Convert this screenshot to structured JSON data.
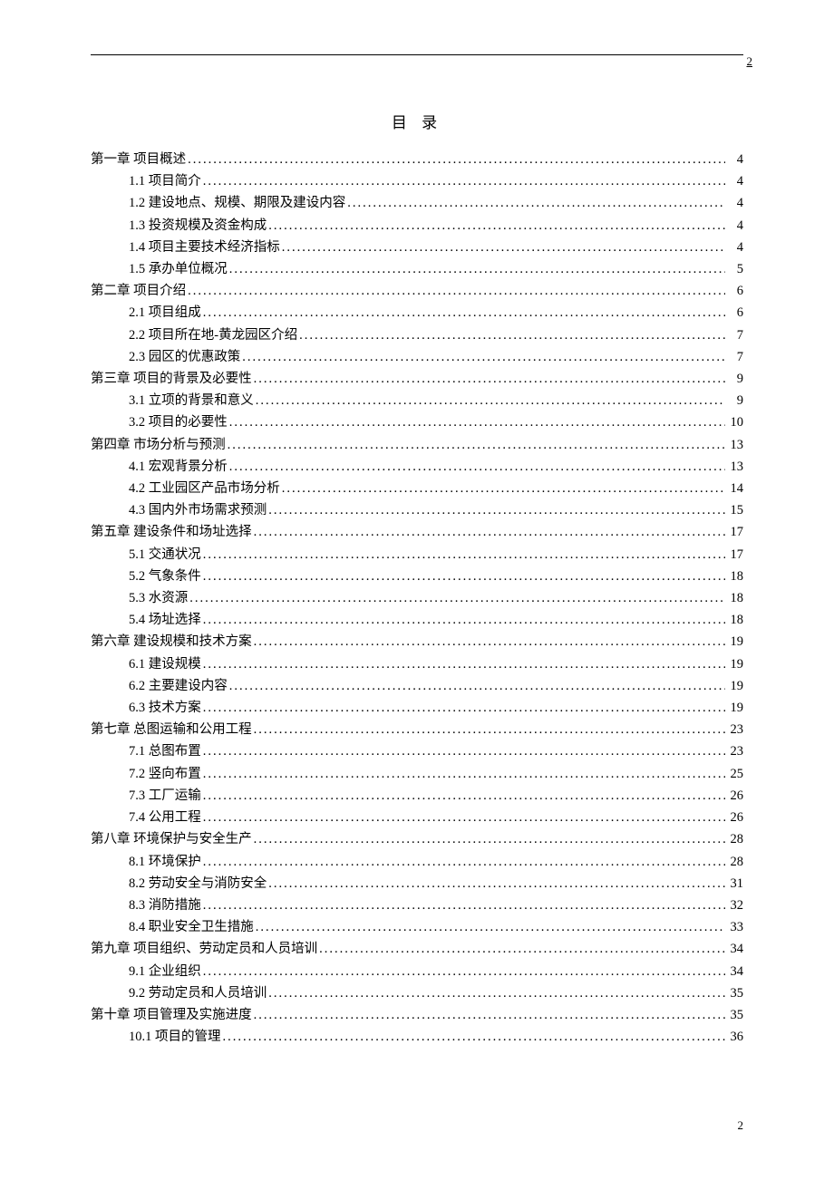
{
  "header_page_number": "2",
  "footer_page_number": "2",
  "title": "目 录",
  "toc": [
    {
      "level": 0,
      "label": "第一章 项目概述",
      "page": "4"
    },
    {
      "level": 1,
      "label": "1.1 项目简介",
      "page": "4"
    },
    {
      "level": 1,
      "label": "1.2 建设地点、规模、期限及建设内容",
      "page": "4"
    },
    {
      "level": 1,
      "label": "1.3 投资规模及资金构成",
      "page": "4"
    },
    {
      "level": 1,
      "label": "1.4 项目主要技术经济指标",
      "page": "4"
    },
    {
      "level": 1,
      "label": "1.5 承办单位概况",
      "page": "5"
    },
    {
      "level": 0,
      "label": "第二章 项目介绍",
      "page": "6"
    },
    {
      "level": 1,
      "label": "2.1 项目组成",
      "page": "6"
    },
    {
      "level": 1,
      "label": "2.2 项目所在地-黄龙园区介绍",
      "page": "7"
    },
    {
      "level": 1,
      "label": "2.3 园区的优惠政策",
      "page": "7"
    },
    {
      "level": 0,
      "label": "第三章 项目的背景及必要性",
      "page": "9"
    },
    {
      "level": 1,
      "label": "3.1 立项的背景和意义",
      "page": "9"
    },
    {
      "level": 1,
      "label": "3.2 项目的必要性",
      "page": "10"
    },
    {
      "level": 0,
      "label": "第四章 市场分析与预测",
      "page": "13"
    },
    {
      "level": 1,
      "label": "4.1 宏观背景分析",
      "page": "13"
    },
    {
      "level": 1,
      "label": "4.2 工业园区产品市场分析",
      "page": "14"
    },
    {
      "level": 1,
      "label": "4.3 国内外市场需求预测",
      "page": "15"
    },
    {
      "level": 0,
      "label": "第五章 建设条件和场址选择",
      "page": "17"
    },
    {
      "level": 1,
      "label": "5.1 交通状况",
      "page": "17"
    },
    {
      "level": 1,
      "label": "5.2 气象条件",
      "page": "18"
    },
    {
      "level": 1,
      "label": "5.3 水资源",
      "page": "18"
    },
    {
      "level": 1,
      "label": "5.4 场址选择",
      "page": "18"
    },
    {
      "level": 0,
      "label": "第六章 建设规模和技术方案",
      "page": "19"
    },
    {
      "level": 1,
      "label": "6.1 建设规模",
      "page": "19"
    },
    {
      "level": 1,
      "label": "6.2 主要建设内容",
      "page": "19"
    },
    {
      "level": 1,
      "label": "6.3 技术方案",
      "page": "19"
    },
    {
      "level": 0,
      "label": "第七章 总图运输和公用工程",
      "page": "23"
    },
    {
      "level": 1,
      "label": "7.1 总图布置",
      "page": "23"
    },
    {
      "level": 1,
      "label": "7.2 竖向布置",
      "page": "25"
    },
    {
      "level": 1,
      "label": "7.3 工厂运输",
      "page": "26"
    },
    {
      "level": 1,
      "label": "7.4 公用工程",
      "page": "26"
    },
    {
      "level": 0,
      "label": "第八章 环境保护与安全生产",
      "page": "28"
    },
    {
      "level": 1,
      "label": "8.1 环境保护",
      "page": "28"
    },
    {
      "level": 1,
      "label": "8.2 劳动安全与消防安全",
      "page": "31"
    },
    {
      "level": 1,
      "label": "8.3 消防措施",
      "page": "32"
    },
    {
      "level": 1,
      "label": "8.4 职业安全卫生措施",
      "page": "33"
    },
    {
      "level": 0,
      "label": "第九章 项目组织、劳动定员和人员培训",
      "page": "34"
    },
    {
      "level": 1,
      "label": "9.1 企业组织",
      "page": "34"
    },
    {
      "level": 1,
      "label": "9.2 劳动定员和人员培训",
      "page": "35"
    },
    {
      "level": 0,
      "label": "第十章 项目管理及实施进度",
      "page": "35"
    },
    {
      "level": 1,
      "label": "10.1 项目的管理",
      "page": "36"
    }
  ]
}
